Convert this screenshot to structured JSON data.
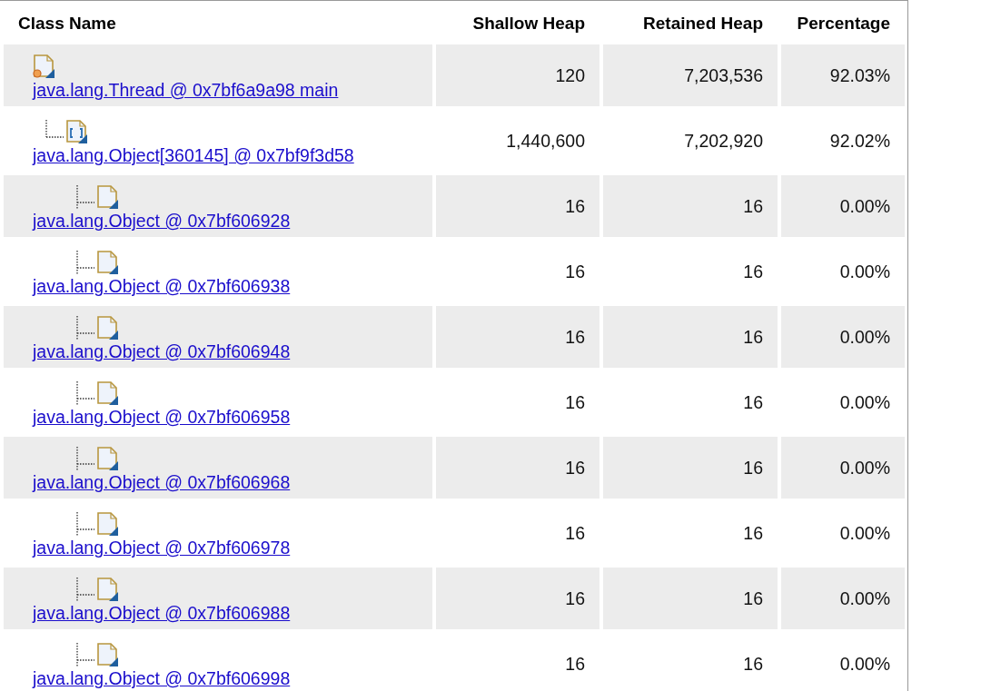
{
  "table": {
    "columns": [
      "Class Name",
      "Shallow Heap",
      "Retained Heap",
      "Percentage"
    ],
    "rows": [
      {
        "kind": "thread",
        "name": "java.lang.Thread @ 0x7bf6a9a98 main",
        "shallow_heap": "120",
        "retained_heap": "7,203,536",
        "percentage": "92.03%",
        "children": [
          {
            "kind": "array",
            "name": "java.lang.Object[360145] @ 0x7bf9f3d58",
            "shallow_heap": "1,440,600",
            "retained_heap": "7,202,920",
            "percentage": "92.02%",
            "children": [
              {
                "kind": "object",
                "name": "java.lang.Object @ 0x7bf606928",
                "shallow_heap": "16",
                "retained_heap": "16",
                "percentage": "0.00%"
              },
              {
                "kind": "object",
                "name": "java.lang.Object @ 0x7bf606938",
                "shallow_heap": "16",
                "retained_heap": "16",
                "percentage": "0.00%"
              },
              {
                "kind": "object",
                "name": "java.lang.Object @ 0x7bf606948",
                "shallow_heap": "16",
                "retained_heap": "16",
                "percentage": "0.00%"
              },
              {
                "kind": "object",
                "name": "java.lang.Object @ 0x7bf606958",
                "shallow_heap": "16",
                "retained_heap": "16",
                "percentage": "0.00%"
              },
              {
                "kind": "object",
                "name": "java.lang.Object @ 0x7bf606968",
                "shallow_heap": "16",
                "retained_heap": "16",
                "percentage": "0.00%"
              },
              {
                "kind": "object",
                "name": "java.lang.Object @ 0x7bf606978",
                "shallow_heap": "16",
                "retained_heap": "16",
                "percentage": "0.00%"
              },
              {
                "kind": "object",
                "name": "java.lang.Object @ 0x7bf606988",
                "shallow_heap": "16",
                "retained_heap": "16",
                "percentage": "0.00%"
              },
              {
                "kind": "object",
                "name": "java.lang.Object @ 0x7bf606998",
                "shallow_heap": "16",
                "retained_heap": "16",
                "percentage": "0.00%"
              }
            ]
          }
        ]
      }
    ]
  }
}
